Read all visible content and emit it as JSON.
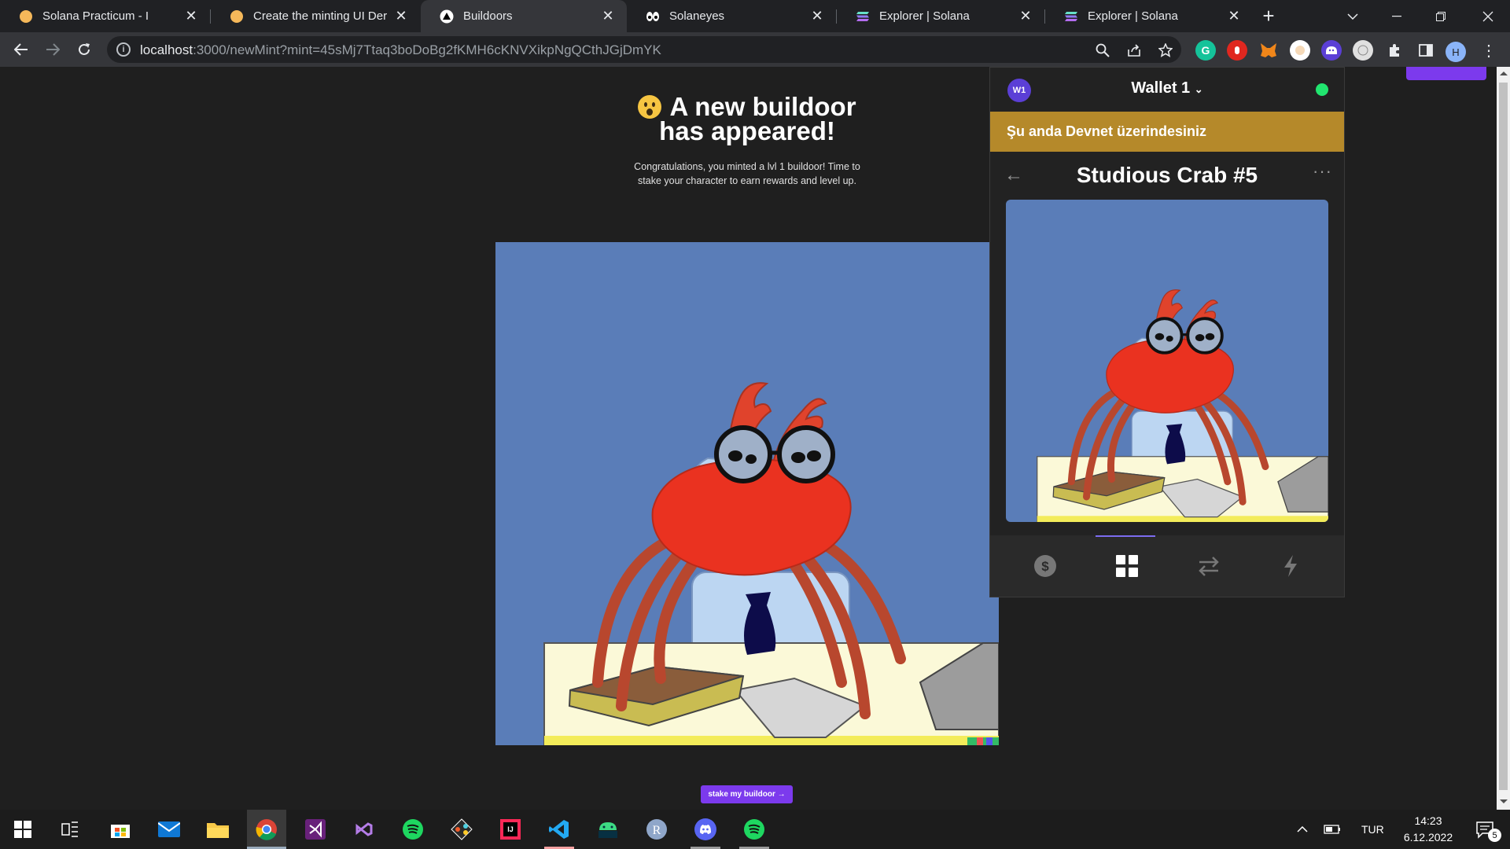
{
  "browser": {
    "tabs": [
      {
        "title": "Solana Practicum - I"
      },
      {
        "title": "Create the minting UI Dersi"
      },
      {
        "title": "Buildoors"
      },
      {
        "title": "Solaneyes"
      },
      {
        "title": "Explorer | Solana"
      },
      {
        "title": "Explorer | Solana"
      }
    ],
    "url_host": "localhost",
    "url_rest": ":3000/newMint?mint=45sMj7Ttaq3boDoBg2fKMH6cKNVXikpNgQCthJGjDmYK",
    "profile_initial": "H"
  },
  "page": {
    "heading_line1": "A new buildoor",
    "heading_line2": "has appeared!",
    "subtitle": "Congratulations, you minted a lvl 1 buildoor! Time to stake your character to earn rewards and level up.",
    "stake_button": "stake my buildoor →"
  },
  "wallet": {
    "badge": "W1",
    "name": "Wallet 1",
    "network_banner": "Şu anda Devnet üzerindesiniz",
    "nft_title": "Studious Crab #5",
    "connected_color": "#21e56f"
  },
  "taskbar": {
    "language": "TUR",
    "time": "14:23",
    "date": "6.12.2022",
    "notifications": "5"
  },
  "colors": {
    "accent_purple": "#7c3aed",
    "banner_gold": "#b5892a",
    "image_background": "#5a7db8"
  }
}
